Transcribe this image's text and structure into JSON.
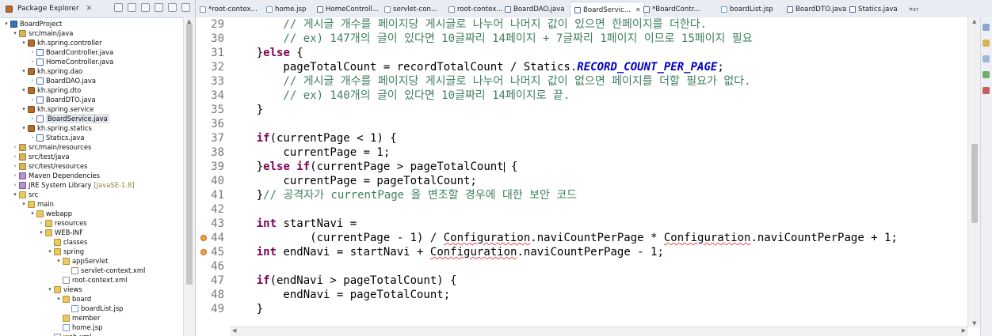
{
  "explorer": {
    "title": "Package Explorer",
    "close": "✕",
    "tree": [
      {
        "label": "BoardProject",
        "depth": 0,
        "twisty": "▾",
        "icon": "project"
      },
      {
        "label": "src/main/java",
        "depth": 1,
        "twisty": "▾",
        "icon": "srcfolder"
      },
      {
        "label": "kh.spring.controller",
        "depth": 2,
        "twisty": "▾",
        "icon": "pkg"
      },
      {
        "label": "BoardController.java",
        "depth": 3,
        "twisty": "›",
        "icon": "java"
      },
      {
        "label": "HomeController.java",
        "depth": 3,
        "twisty": "›",
        "icon": "java"
      },
      {
        "label": "kh.spring.dao",
        "depth": 2,
        "twisty": "▾",
        "icon": "pkg"
      },
      {
        "label": "BoardDAO.java",
        "depth": 3,
        "twisty": "›",
        "icon": "java"
      },
      {
        "label": "kh.spring.dto",
        "depth": 2,
        "twisty": "▾",
        "icon": "pkg"
      },
      {
        "label": "BoardDTO.java",
        "depth": 3,
        "twisty": "›",
        "icon": "java"
      },
      {
        "label": "kh.spring.service",
        "depth": 2,
        "twisty": "▾",
        "icon": "pkg"
      },
      {
        "label": "BoardService.java",
        "depth": 3,
        "twisty": "›",
        "icon": "java",
        "selected": true
      },
      {
        "label": "kh.spring.statics",
        "depth": 2,
        "twisty": "▾",
        "icon": "pkg"
      },
      {
        "label": "Statics.java",
        "depth": 3,
        "twisty": "›",
        "icon": "java"
      },
      {
        "label": "src/main/resources",
        "depth": 1,
        "twisty": "›",
        "icon": "srcfolder"
      },
      {
        "label": "src/test/java",
        "depth": 1,
        "twisty": "›",
        "icon": "srcfolder"
      },
      {
        "label": "src/test/resources",
        "depth": 1,
        "twisty": "›",
        "icon": "srcfolder"
      },
      {
        "label": "Maven Dependencies",
        "depth": 1,
        "twisty": "›",
        "icon": "lib"
      },
      {
        "label": "JRE System Library",
        "extra": "[JavaSE-1.8]",
        "depth": 1,
        "twisty": "›",
        "icon": "lib"
      },
      {
        "label": "src",
        "depth": 1,
        "twisty": "▾",
        "icon": "folder"
      },
      {
        "label": "main",
        "depth": 2,
        "twisty": "▾",
        "icon": "folder"
      },
      {
        "label": "webapp",
        "depth": 3,
        "twisty": "▾",
        "icon": "folder"
      },
      {
        "label": "resources",
        "depth": 4,
        "twisty": "›",
        "icon": "folder"
      },
      {
        "label": "WEB-INF",
        "depth": 4,
        "twisty": "▾",
        "icon": "folder"
      },
      {
        "label": "classes",
        "depth": 5,
        "twisty": "",
        "icon": "folder"
      },
      {
        "label": "spring",
        "depth": 5,
        "twisty": "▾",
        "icon": "folder"
      },
      {
        "label": "appServlet",
        "depth": 6,
        "twisty": "▾",
        "icon": "folder"
      },
      {
        "label": "servlet-context.xml",
        "depth": 7,
        "twisty": "",
        "icon": "xml"
      },
      {
        "label": "root-context.xml",
        "depth": 6,
        "twisty": "",
        "icon": "xml"
      },
      {
        "label": "views",
        "depth": 5,
        "twisty": "▾",
        "icon": "folder"
      },
      {
        "label": "board",
        "depth": 6,
        "twisty": "▾",
        "icon": "folder"
      },
      {
        "label": "boardList.jsp",
        "depth": 7,
        "twisty": "",
        "icon": "jsp"
      },
      {
        "label": "member",
        "depth": 6,
        "twisty": "",
        "icon": "folder"
      },
      {
        "label": "home.jsp",
        "depth": 6,
        "twisty": "",
        "icon": "jsp"
      },
      {
        "label": "web.xml",
        "depth": 5,
        "twisty": "",
        "icon": "xml"
      }
    ]
  },
  "tabs": [
    {
      "label": "*root-contex...",
      "icon": "xml"
    },
    {
      "label": "home.jsp",
      "icon": "jsp"
    },
    {
      "label": "HomeControll...",
      "icon": "java"
    },
    {
      "label": "servlet-con...",
      "icon": "xml"
    },
    {
      "label": "root-contex...",
      "icon": "xml"
    },
    {
      "label": "BoardDAO.java",
      "icon": "java"
    },
    {
      "label": "BoardServic...",
      "icon": "java",
      "active": true
    },
    {
      "label": "*BoardContr...",
      "icon": "java"
    },
    {
      "label": "boardList.jsp",
      "icon": "jsp"
    },
    {
      "label": "BoardDTO.java",
      "icon": "java"
    },
    {
      "label": "Statics.java",
      "icon": "java"
    },
    {
      "label": "»₃₇",
      "icon": ""
    }
  ],
  "tab_close": "✕",
  "editor": {
    "lines": [
      {
        "n": "29",
        "s": [
          [
            "cm",
            "        // 게시글 개수를 페이지당 게시글로 나누어 나머지 값이 있으면 한페이지를 더한다."
          ]
        ]
      },
      {
        "n": "30",
        "s": [
          [
            "cm",
            "        // ex) 147개의 글이 있다면 10글짜리 14페이지 + 7글짜리 1페이지 이므로 15페이지 필요"
          ]
        ]
      },
      {
        "n": "31",
        "s": [
          [
            "t",
            "    }"
          ],
          [
            "kw",
            "else"
          ],
          [
            "t",
            " {"
          ]
        ]
      },
      {
        "n": "32",
        "s": [
          [
            "t",
            "        pageTotalCount = recordTotalCount / Statics."
          ],
          [
            "st",
            "RECORD_COUNT_PER_PAGE"
          ],
          [
            "t",
            ";"
          ]
        ]
      },
      {
        "n": "33",
        "s": [
          [
            "cm",
            "        // 게시글 개수를 페이지당 게시글로 나누어 나머지 값이 없으면 페이지를 더할 필요가 없다."
          ]
        ]
      },
      {
        "n": "34",
        "s": [
          [
            "cm",
            "        // ex) 140개의 글이 있다면 10글짜리 14페이지로 끝."
          ]
        ]
      },
      {
        "n": "35",
        "s": [
          [
            "t",
            "    }"
          ]
        ]
      },
      {
        "n": "36",
        "s": []
      },
      {
        "n": "37",
        "s": [
          [
            "t",
            "    "
          ],
          [
            "kw",
            "if"
          ],
          [
            "t",
            "(currentPage < 1) {"
          ]
        ]
      },
      {
        "n": "38",
        "s": [
          [
            "t",
            "        currentPage = 1;"
          ]
        ]
      },
      {
        "n": "39",
        "s": [
          [
            "t",
            "    }"
          ],
          [
            "kw",
            "else if"
          ],
          [
            "t",
            "(currentPage > pageTotalCount"
          ],
          [
            "caret",
            ""
          ],
          [
            "t",
            " {"
          ]
        ]
      },
      {
        "n": "40",
        "s": [
          [
            "t",
            "        currentPage = pageTotalCount;"
          ]
        ]
      },
      {
        "n": "41",
        "s": [
          [
            "t",
            "    }"
          ],
          [
            "cm",
            "// 공격자가 currentPage 을 변조할 경우에 대한 보안 코드"
          ]
        ]
      },
      {
        "n": "42",
        "s": []
      },
      {
        "n": "43",
        "s": [
          [
            "t",
            "    "
          ],
          [
            "kw",
            "int"
          ],
          [
            "t",
            " startNavi ="
          ]
        ]
      },
      {
        "n": "44",
        "s": [
          [
            "t",
            "            (currentPage - 1) / "
          ],
          [
            "err",
            "Configuration"
          ],
          [
            "t",
            ".naviCountPerPage * "
          ],
          [
            "err",
            "Configuration"
          ],
          [
            "t",
            ".naviCountPerPage + 1;"
          ]
        ],
        "marker": true
      },
      {
        "n": "45",
        "s": [
          [
            "t",
            "    "
          ],
          [
            "kw",
            "int"
          ],
          [
            "t",
            " endNavi = startNavi + "
          ],
          [
            "err",
            "Configuration"
          ],
          [
            "t",
            ".naviCountPerPage - 1;"
          ]
        ],
        "marker": true
      },
      {
        "n": "46",
        "s": []
      },
      {
        "n": "47",
        "s": [
          [
            "t",
            "    "
          ],
          [
            "kw",
            "if"
          ],
          [
            "t",
            "(endNavi > pageTotalCount) {"
          ]
        ]
      },
      {
        "n": "48",
        "s": [
          [
            "t",
            "        endNavi = pageTotalCount;"
          ]
        ]
      },
      {
        "n": "49",
        "s": [
          [
            "t",
            "    }"
          ]
        ]
      }
    ]
  }
}
